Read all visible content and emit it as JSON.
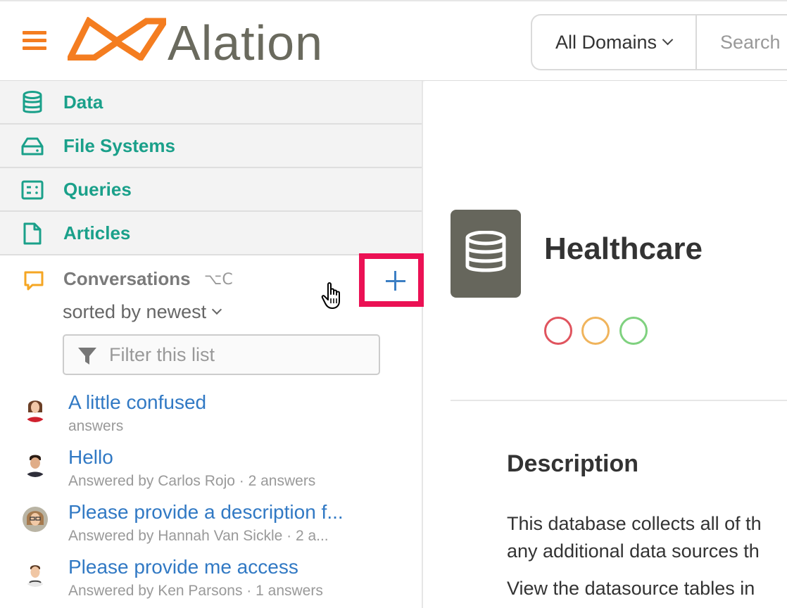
{
  "header": {
    "logo_text": "Alation",
    "domain_select": "All Domains",
    "search_placeholder": "Search"
  },
  "sidebar": {
    "nav_items": [
      {
        "label": "Data",
        "icon": "database-icon"
      },
      {
        "label": "File Systems",
        "icon": "drive-icon"
      },
      {
        "label": "Queries",
        "icon": "query-icon"
      },
      {
        "label": "Articles",
        "icon": "article-icon"
      }
    ],
    "conversations": {
      "title": "Conversations",
      "shortcut": "⌥C",
      "sort_label": "sorted by newest",
      "filter_placeholder": "Filter this list",
      "items": [
        {
          "title": "A little confused",
          "subtitle": "answers"
        },
        {
          "title": "Hello",
          "subtitle": "Answered by Carlos Rojo · 2 answers"
        },
        {
          "title": "Please provide a description f...",
          "subtitle": "Answered by Hannah Van Sickle · 2 a..."
        },
        {
          "title": "Please provide me access",
          "subtitle": "Answered by Ken Parsons · 1 answers"
        }
      ]
    }
  },
  "main": {
    "title": "Healthcare",
    "status_colors": [
      "#e0545e",
      "#f0b45c",
      "#7fd17f"
    ],
    "description_heading": "Description",
    "description_line1": "This database collects all of th",
    "description_line2": "any additional data sources th",
    "description_line3": "View the datasource tables in"
  },
  "colors": {
    "accent_orange": "#f47d20",
    "nav_teal": "#1aa08a",
    "link_blue": "#3179c4",
    "highlight_red": "#eb1154"
  }
}
